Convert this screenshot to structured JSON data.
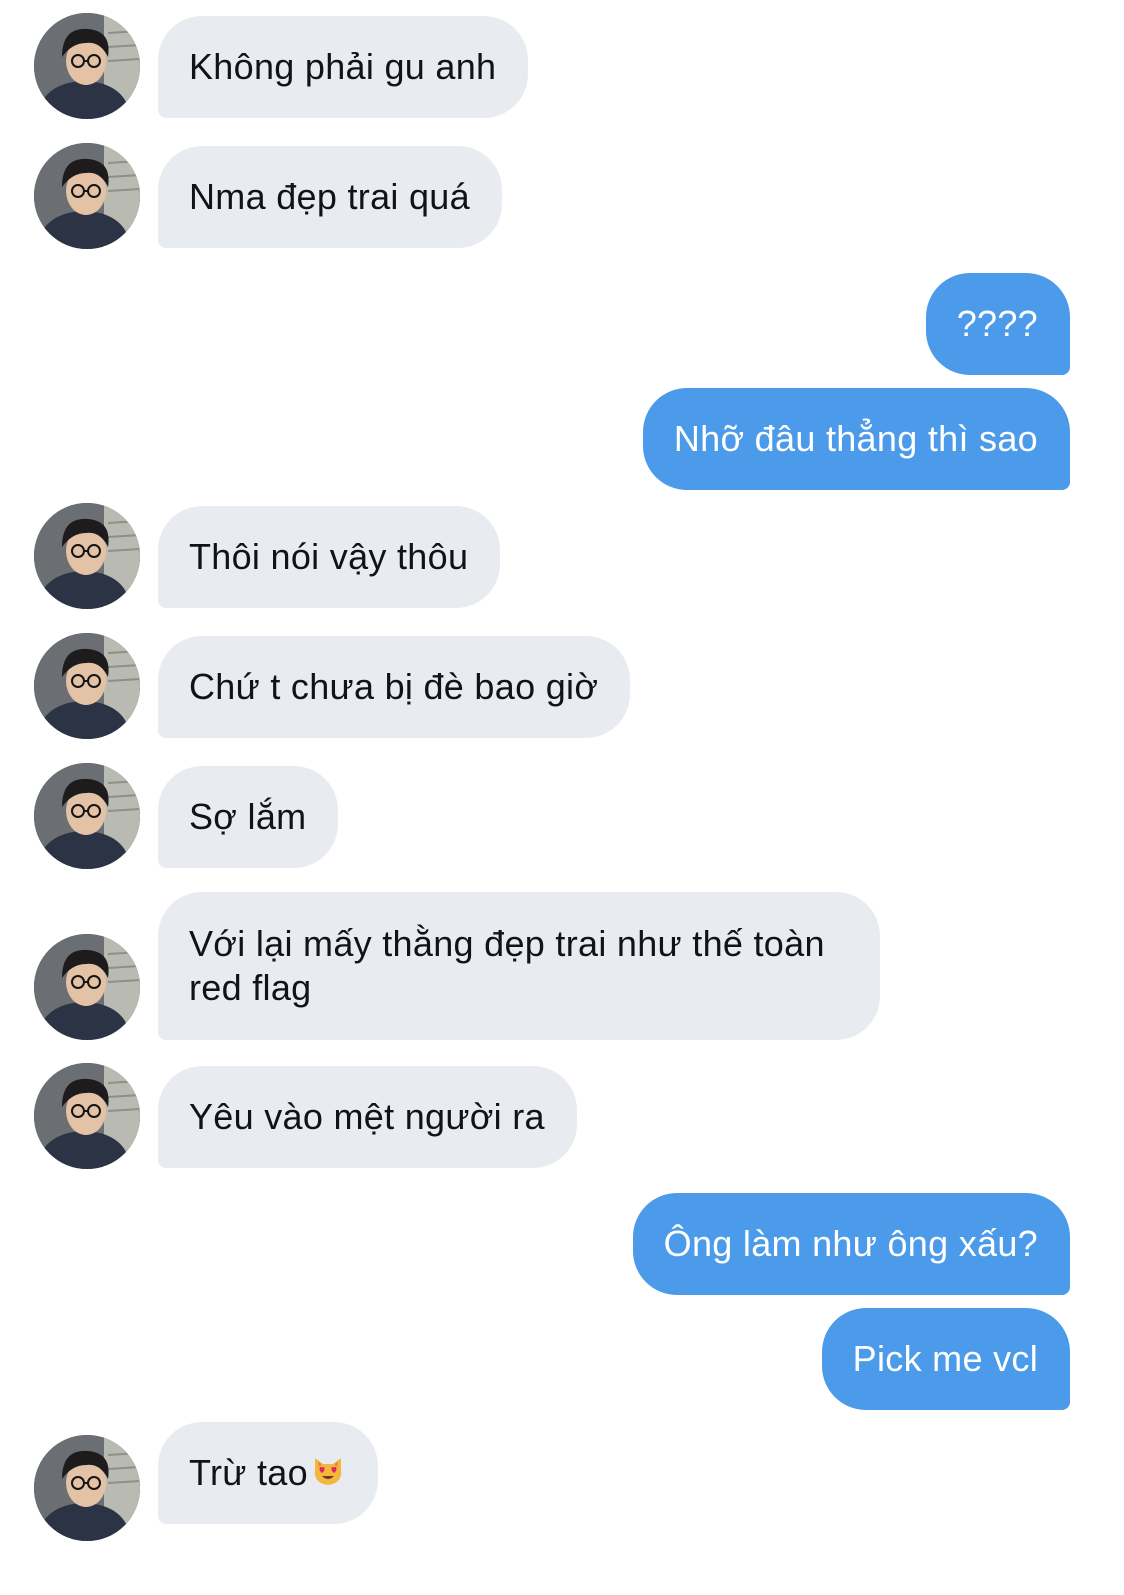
{
  "conversation": {
    "messages": [
      {
        "side": "in",
        "text": "Không phải gu anh"
      },
      {
        "side": "in",
        "text": "Nma đẹp trai quá"
      },
      {
        "side": "out",
        "text": "????"
      },
      {
        "side": "out",
        "text": "Nhỡ đâu thẳng thì sao"
      },
      {
        "side": "in",
        "text": "Thôi nói vậy thôu"
      },
      {
        "side": "in",
        "text": "Chứ t chưa bị đè bao giờ"
      },
      {
        "side": "in",
        "text": "Sợ lắm"
      },
      {
        "side": "in",
        "text": "Với lại mấy thằng đẹp trai như thế toàn red flag"
      },
      {
        "side": "in",
        "text": "Yêu vào mệt người ra"
      },
      {
        "side": "out",
        "text": "Ông làm như ông xấu?"
      },
      {
        "side": "out",
        "text": "Pick me vcl"
      },
      {
        "side": "in",
        "text": "Trừ tao",
        "emoji": "heart-eyes-cat-emoji"
      }
    ]
  },
  "colors": {
    "incoming_bubble": "#e8ecf0",
    "incoming_text": "#101418",
    "outgoing_bubble": "#4b9bea",
    "outgoing_text": "#ffffff",
    "background": "#ffffff"
  }
}
